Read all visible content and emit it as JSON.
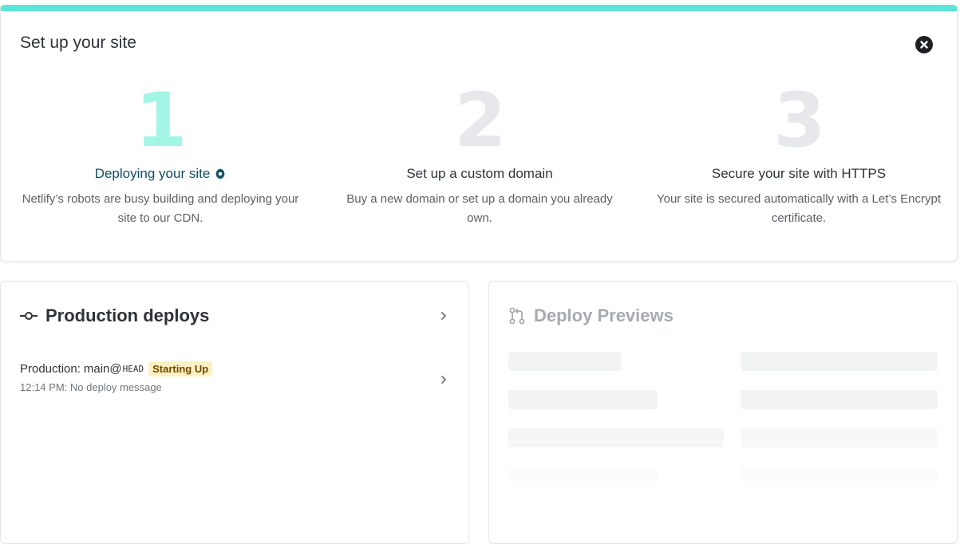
{
  "setup": {
    "title": "Set up your site",
    "close_icon": "close-icon",
    "accent": "#5ce5d8",
    "steps": [
      {
        "number": "1",
        "heading": "Deploying your site",
        "description": "Netlify’s robots are busy building and deploying your site to our CDN.",
        "icon": "gear-icon",
        "active": true
      },
      {
        "number": "2",
        "heading": "Set up a custom domain",
        "description": "Buy a new domain or set up a domain you already own.",
        "active": false
      },
      {
        "number": "3",
        "heading": "Secure your site with HTTPS",
        "description": "Your site is secured automatically with a Let’s Encrypt certificate.",
        "active": false
      }
    ]
  },
  "production": {
    "title": "Production deploys",
    "icon": "commit-icon",
    "deploys": [
      {
        "context": "Production",
        "branch": "main@",
        "ref": "HEAD",
        "status": "Starting Up",
        "time": "12:14 PM",
        "message": "No deploy message"
      }
    ]
  },
  "previews": {
    "title": "Deploy Previews",
    "icon": "pull-request-icon",
    "loading": true
  },
  "colors": {
    "status_badge_bg": "#fdf1c2",
    "status_badge_text": "#6d4a00",
    "step_active_number": "#a3f5e4",
    "step_inactive_number": "#e6e8eb",
    "link_heading": "#0e4e62"
  }
}
